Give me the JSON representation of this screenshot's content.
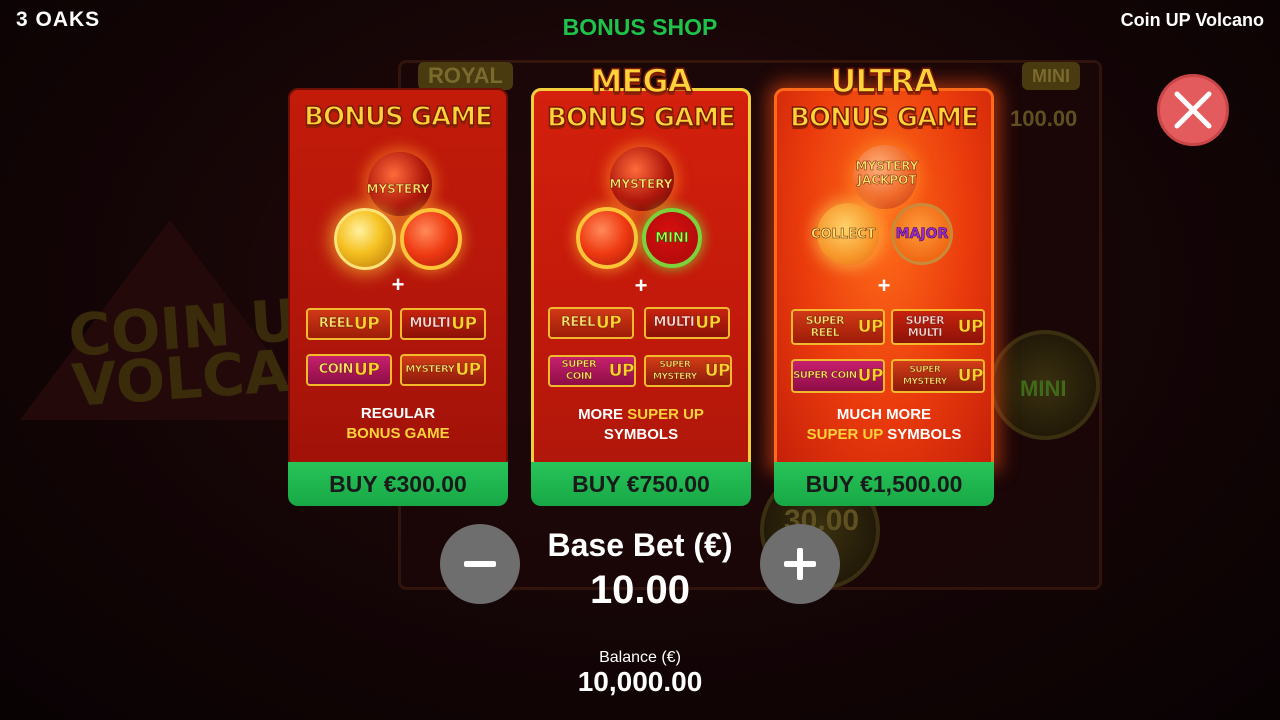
{
  "header": {
    "brand": "3 OAKS",
    "title": "BONUS SHOP",
    "game_name": "Coin UP Volcano"
  },
  "background": {
    "jackpots": [
      "ROYAL",
      "MINI"
    ],
    "jackpot_value": "100.00",
    "logo_line1": "COIN UP",
    "logo_line2": "VOLCANO",
    "coin_value": "30.00",
    "coin_label": "MINI"
  },
  "cards": [
    {
      "tier": "",
      "heading": "BONUS GAME",
      "orbs": [
        "MYSTERY"
      ],
      "mini_label": "",
      "symbols": [
        {
          "top": "REEL",
          "bottom": "UP"
        },
        {
          "top": "MULTI",
          "bottom": "UP"
        },
        {
          "top": "COIN",
          "bottom": "UP"
        },
        {
          "top": "MYSTERY",
          "bottom": "UP"
        }
      ],
      "desc_line1": "REGULAR",
      "desc_line2": "BONUS GAME",
      "buy_label": "BUY €300.00"
    },
    {
      "tier": "MEGA",
      "heading": "BONUS GAME",
      "orbs": [
        "MYSTERY"
      ],
      "mini_label": "MINI",
      "symbols": [
        {
          "top": "REEL",
          "bottom": "UP"
        },
        {
          "top": "MULTI",
          "bottom": "UP"
        },
        {
          "top": "SUPER COIN",
          "bottom": "UP"
        },
        {
          "top": "SUPER MYSTERY",
          "bottom": "UP"
        }
      ],
      "desc_line1_a": "MORE ",
      "desc_line1_b": "SUPER UP",
      "desc_line2": "SYMBOLS",
      "buy_label": "BUY €750.00"
    },
    {
      "tier": "ULTRA",
      "heading": "BONUS GAME",
      "orbs": [
        "MYSTERY JACKPOT"
      ],
      "collect_label": "COLLECT",
      "major_label": "MAJOR",
      "symbols": [
        {
          "top": "SUPER REEL",
          "bottom": "UP"
        },
        {
          "top": "SUPER MULTI",
          "bottom": "UP"
        },
        {
          "top": "SUPER COIN",
          "bottom": "UP"
        },
        {
          "top": "SUPER MYSTERY",
          "bottom": "UP"
        }
      ],
      "desc_line1": "MUCH MORE",
      "desc_line2_a": "SUPER UP",
      "desc_line2_b": " SYMBOLS",
      "buy_label": "BUY €1,500.00"
    }
  ],
  "bet": {
    "label": "Base Bet (€)",
    "value": "10.00"
  },
  "balance": {
    "label": "Balance (€)",
    "value": "10,000.00"
  },
  "colors": {
    "accent_green": "#1fc24a",
    "close_red": "#e45b5e",
    "card_red": "#c21b0a",
    "gold": "#ffd43a"
  }
}
